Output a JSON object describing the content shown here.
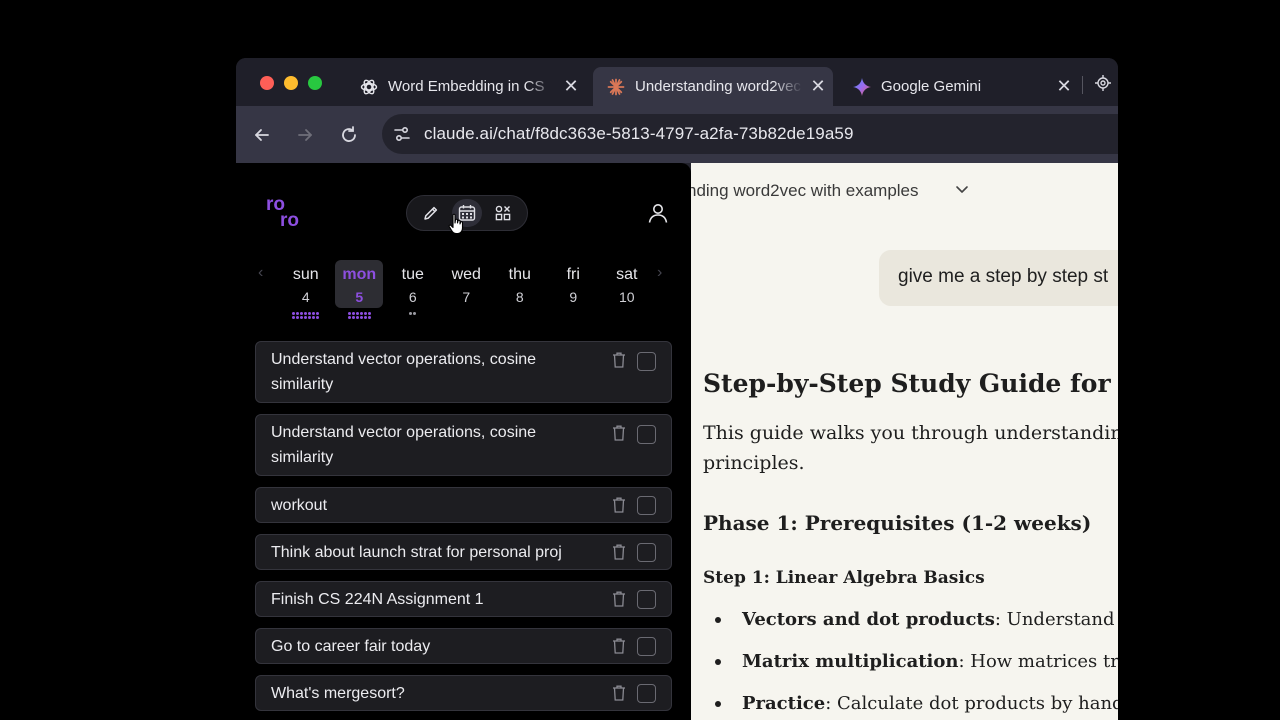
{
  "browser": {
    "tabs": [
      {
        "title": "Word Embedding in CS",
        "icon": "openai-icon",
        "active": false
      },
      {
        "title": "Understanding word2vec",
        "icon": "claude-icon",
        "active": true
      },
      {
        "title": "Google Gemini",
        "icon": "gemini-icon",
        "active": false
      }
    ],
    "close_glyph": "✕",
    "url": "claude.ai/chat/f8dc363e-5813-4797-a2fa-73b82de19a59"
  },
  "roro": {
    "logo_top": "ro",
    "logo_bottom": "ro",
    "days": [
      {
        "name": "sun",
        "date": "4"
      },
      {
        "name": "mon",
        "date": "5"
      },
      {
        "name": "tue",
        "date": "6"
      },
      {
        "name": "wed",
        "date": "7"
      },
      {
        "name": "thu",
        "date": "8"
      },
      {
        "name": "fri",
        "date": "9"
      },
      {
        "name": "sat",
        "date": "10"
      }
    ],
    "prev_glyph": "‹",
    "next_glyph": "›",
    "todos": [
      "Understand vector operations, cosine similarity",
      "Understand vector operations, cosine similarity",
      "workout",
      "Think about launch strat for personal proj",
      "Finish CS 224N Assignment 1",
      "Go to career fair today",
      "What's mergesort?"
    ]
  },
  "claude": {
    "conversation_title": "nding word2vec with examples",
    "chevron": "⌵",
    "user_message": "give me a step by step st",
    "heading": "Step-by-Step Study Guide for Or",
    "intro_line1": "This guide walks you through understanding t",
    "intro_line2": "principles.",
    "phase": "Phase 1: Prerequisites (1-2 weeks)",
    "step": "Step 1: Linear Algebra Basics",
    "bullets": [
      {
        "bold": "Vectors and dot products",
        "rest": ": Understand ve"
      },
      {
        "bold": "Matrix multiplication",
        "rest": ": How matrices tran"
      },
      {
        "bold": "Practice",
        "rest": ": Calculate dot products by hand, "
      }
    ]
  },
  "colors": {
    "accent": "#8d4fe0",
    "claude_bg": "#f6f5ef"
  }
}
